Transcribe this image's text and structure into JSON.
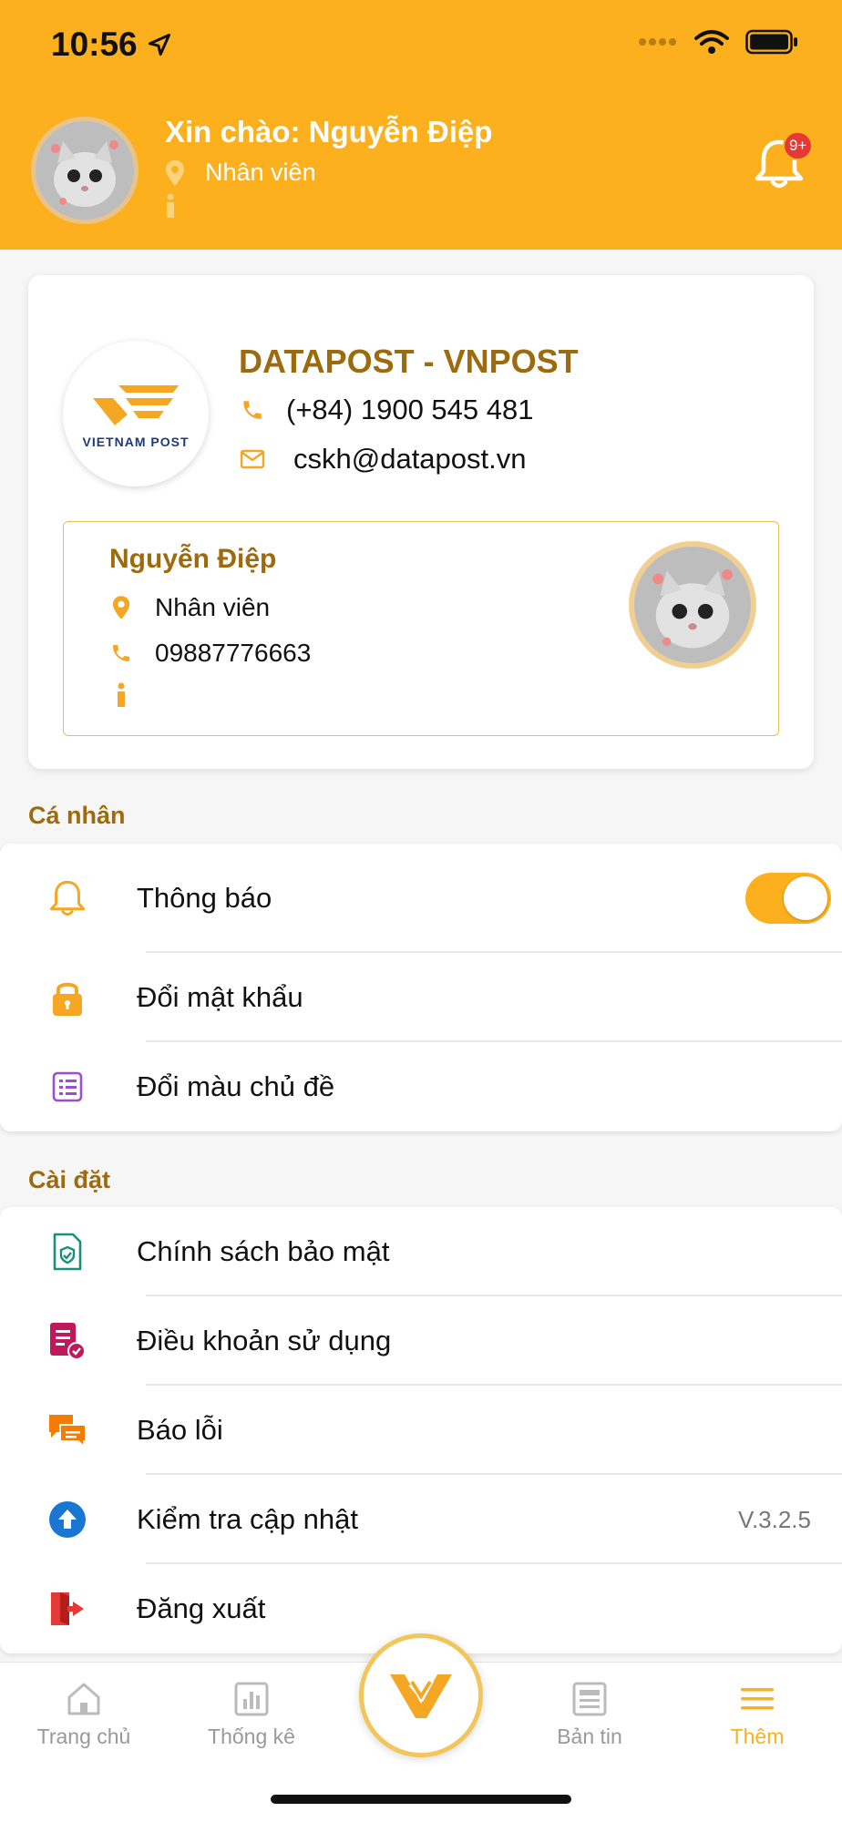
{
  "status_bar": {
    "time": "10:56"
  },
  "header": {
    "greeting": "Xin chào: Nguyễn Điệp",
    "role": "Nhân viên",
    "notification_badge": "9+"
  },
  "company": {
    "logo_text": "VIETNAM POST",
    "name": "DATAPOST - VNPOST",
    "phone": "(+84) 1900 545 481",
    "email": "cskh@datapost.vn"
  },
  "employee": {
    "name": "Nguyễn Điệp",
    "role": "Nhân viên",
    "phone": "09887776663"
  },
  "sections": {
    "personal": {
      "title": "Cá nhân",
      "items": [
        {
          "label": "Thông báo",
          "icon": "bell-icon",
          "toggle_on": true
        },
        {
          "label": "Đổi mật khẩu",
          "icon": "lock-icon"
        },
        {
          "label": "Đổi màu chủ đề",
          "icon": "list-icon"
        }
      ]
    },
    "settings": {
      "title": "Cài đặt",
      "items": [
        {
          "label": "Chính sách bảo mật",
          "icon": "shield-document-icon"
        },
        {
          "label": "Điều khoản sử dụng",
          "icon": "terms-icon"
        },
        {
          "label": "Báo lỗi",
          "icon": "chat-icon"
        },
        {
          "label": "Kiểm tra cập nhật",
          "icon": "upload-icon",
          "version": "V.3.2.5"
        },
        {
          "label": "Đăng xuất",
          "icon": "logout-icon"
        }
      ]
    }
  },
  "tabbar": {
    "items": [
      {
        "label": "Trang chủ",
        "icon": "home-icon",
        "active": false
      },
      {
        "label": "Thống kê",
        "icon": "chart-icon",
        "active": false
      },
      {
        "label": "Bản tin",
        "icon": "news-icon",
        "active": false
      },
      {
        "label": "Thêm",
        "icon": "menu-icon",
        "active": true
      }
    ]
  },
  "colors": {
    "accent": "#fdb01d",
    "title_brown": "#9c6b0e"
  }
}
